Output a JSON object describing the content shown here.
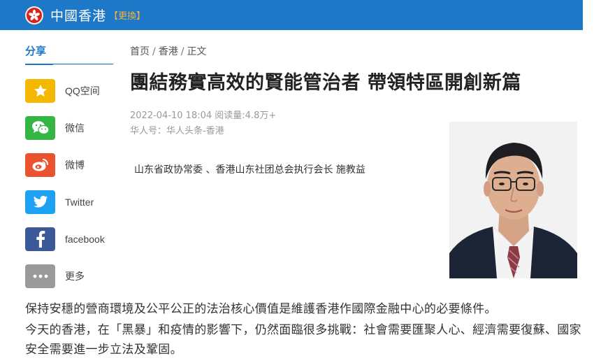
{
  "header": {
    "site_title": "中國香港",
    "switch_label": "【更換】",
    "emblem_icon": "hk-bauhinia-emblem",
    "bar_color": "#1e78c8"
  },
  "share": {
    "heading": "分享",
    "items": [
      {
        "label": "QQ空间",
        "icon": "qzone-star-icon",
        "color": "#f5b800"
      },
      {
        "label": "微信",
        "icon": "wechat-icon",
        "color": "#35b544"
      },
      {
        "label": "微博",
        "icon": "weibo-icon",
        "color": "#ea5230"
      },
      {
        "label": "Twitter",
        "icon": "twitter-icon",
        "color": "#1da1f2"
      },
      {
        "label": "facebook",
        "icon": "facebook-icon",
        "color": "#3b5998"
      },
      {
        "label": "更多",
        "icon": "more-icon",
        "color": "#9a9a9a"
      }
    ]
  },
  "breadcrumb": {
    "home": "首页",
    "section": "香港",
    "current": "正文",
    "separator": "/"
  },
  "article": {
    "title": "團結務實高效的賢能管治者 帶領特區開創新篇",
    "datetime": "2022-04-10 18:04",
    "views": "阅读量:4.8万+",
    "source": "华人号：华人头条-香港",
    "author_line": "山东省政协常委 、香港山东社团总会执行会长 施教益",
    "paragraphs": [
      "保持安穩的營商環境及公平公正的法治核心價值是維護香港作國際金融中心的必要條件。",
      "今天的香港，在「黑暴」和疫情的影響下，仍然面臨很多挑戰：社會需要匯聚人心、經濟需要復蘇、國家安全需要進一步立法及鞏固。"
    ]
  }
}
